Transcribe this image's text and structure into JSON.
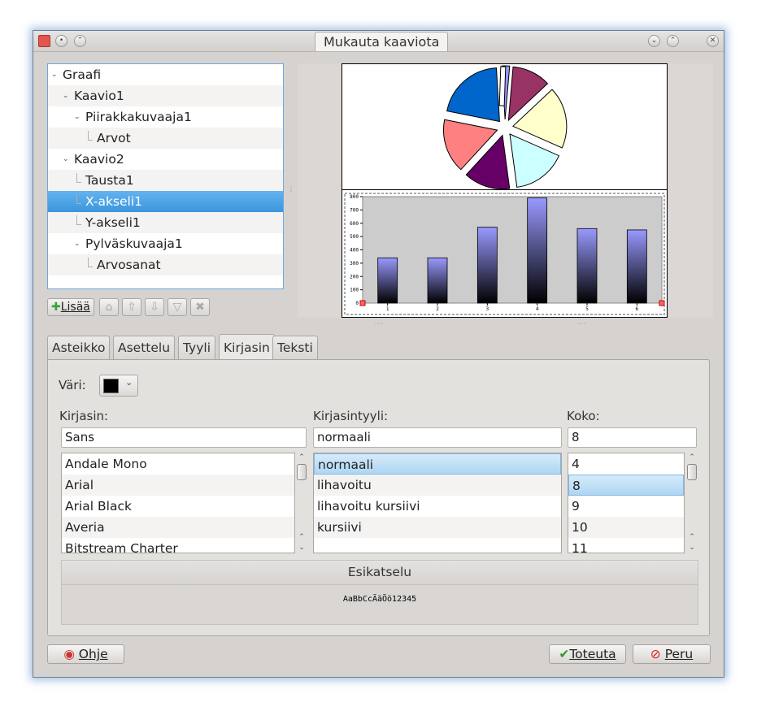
{
  "window": {
    "title": "Mukauta kaaviota"
  },
  "tree": {
    "items": [
      {
        "label": "Graafi",
        "level": 0,
        "expandable": true
      },
      {
        "label": "Kaavio1",
        "level": 1,
        "expandable": true
      },
      {
        "label": "Piirakkakuvaaja1",
        "level": 2,
        "expandable": true
      },
      {
        "label": "Arvot",
        "level": 3,
        "expandable": false
      },
      {
        "label": "Kaavio2",
        "level": 1,
        "expandable": true
      },
      {
        "label": "Tausta1",
        "level": 2,
        "expandable": false
      },
      {
        "label": "X-akseli1",
        "level": 2,
        "expandable": false,
        "selected": true
      },
      {
        "label": "Y-akseli1",
        "level": 2,
        "expandable": false
      },
      {
        "label": "Pylväskuvaaja1",
        "level": 2,
        "expandable": true
      },
      {
        "label": "Arvosanat",
        "level": 3,
        "expandable": false
      }
    ]
  },
  "tree_toolbar": {
    "add_label": "Lisää",
    "icons": [
      "add-icon",
      "clear-icon",
      "move-up-icon",
      "move-down-icon",
      "filter-icon",
      "delete-icon"
    ]
  },
  "tabs": [
    "Asteikko",
    "Asettelu",
    "Tyyli",
    "Kirjasin",
    "Teksti"
  ],
  "active_tab": "Kirjasin",
  "font": {
    "color_label": "Väri:",
    "color_value": "#000000",
    "family_label": "Kirjasin:",
    "family_value": "Sans",
    "family_options": [
      "Andale Mono",
      "Arial",
      "Arial Black",
      "Averia",
      "Bitstream Charter"
    ],
    "style_label": "Kirjasintyyli:",
    "style_value": "normaali",
    "style_options": [
      "normaali",
      "lihavoitu",
      "lihavoitu kursiivi",
      "kursiivi"
    ],
    "size_label": "Koko:",
    "size_value": "8",
    "size_options": [
      "4",
      "8",
      "9",
      "10",
      "11"
    ],
    "preview_title": "Esikatselu",
    "preview_sample": "AaBbCcÄäÖö12345"
  },
  "buttons": {
    "help": "Ohje",
    "apply": "Toteuta",
    "cancel": "Peru"
  },
  "chart_data": [
    {
      "type": "pie",
      "values": [
        2,
        10,
        16,
        14,
        12,
        14,
        18
      ],
      "colors": [
        "#ffffff",
        "#9999ff",
        "#993366",
        "#ffffcc",
        "#ccffff",
        "#660066",
        "#ff8080",
        "#0066cc"
      ],
      "exploded": true
    },
    {
      "type": "bar",
      "categories": [
        "1",
        "2",
        "3",
        "4",
        "5",
        "6"
      ],
      "values": [
        340,
        340,
        570,
        790,
        560,
        550
      ],
      "ylim": [
        0,
        800
      ],
      "yticks": [
        "0",
        "100",
        "200",
        "300",
        "400",
        "500",
        "600",
        "700",
        "800"
      ],
      "grid": false,
      "background": "#cccccc",
      "bar_gradient": [
        "#9999ff",
        "#000000"
      ]
    }
  ]
}
